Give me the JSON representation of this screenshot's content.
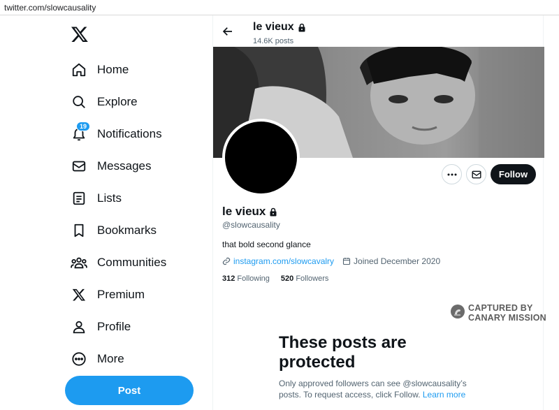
{
  "browser": {
    "url": "twitter.com/slowcausality"
  },
  "sidebar": {
    "logo": "x-logo-icon",
    "items": [
      {
        "label": "Home",
        "icon": "home-icon"
      },
      {
        "label": "Explore",
        "icon": "search-icon"
      },
      {
        "label": "Notifications",
        "icon": "bell-icon",
        "badge": "19"
      },
      {
        "label": "Messages",
        "icon": "envelope-icon"
      },
      {
        "label": "Lists",
        "icon": "list-icon"
      },
      {
        "label": "Bookmarks",
        "icon": "bookmark-icon"
      },
      {
        "label": "Communities",
        "icon": "communities-icon"
      },
      {
        "label": "Premium",
        "icon": "x-logo-icon"
      },
      {
        "label": "Profile",
        "icon": "person-icon"
      },
      {
        "label": "More",
        "icon": "more-circle-icon"
      }
    ],
    "post_label": "Post"
  },
  "header": {
    "name": "le vieux",
    "posts_count": "14.6K posts"
  },
  "profile": {
    "name": "le vieux",
    "handle": "@slowcausality",
    "bio": "that bold second glance",
    "link": "instagram.com/slowcavalry",
    "joined": "Joined December 2020",
    "following_count": "312",
    "following_label": "Following",
    "followers_count": "520",
    "followers_label": "Followers",
    "follow_label": "Follow"
  },
  "watermark": {
    "line1": "CAPTURED BY",
    "line2": "CANARY MISSION"
  },
  "protected": {
    "title": "These posts are protected",
    "body": "Only approved followers can see @slowcausality’s posts. To request access, click Follow.",
    "learn_more": "Learn more"
  },
  "colors": {
    "accent": "#1d9bf0",
    "text": "#0f1419",
    "muted": "#536471"
  }
}
